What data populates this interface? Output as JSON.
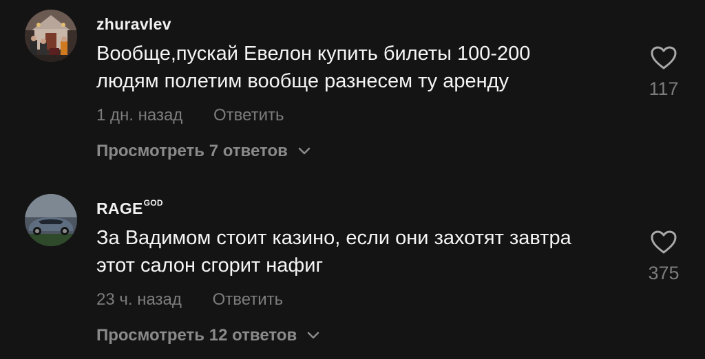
{
  "comments": [
    {
      "username": "zhuravlev",
      "username_sup": "",
      "text_lines": [
        "Вообще,пускай Евелон купить билеты 100-200",
        "людям полетим вообще разнесем ту аренду"
      ],
      "time": "1 дн. назад",
      "reply_label": "Ответить",
      "view_replies": "Просмотреть 7 ответов",
      "likes": "117"
    },
    {
      "username": "RAGE",
      "username_sup": "GOD",
      "text_lines": [
        "За Вадимом стоит казино, если они захотят завтра",
        "этот салон сгорит нафиг"
      ],
      "time": "23 ч. назад",
      "reply_label": "Ответить",
      "view_replies": "Просмотреть 12 ответов",
      "likes": "375"
    }
  ],
  "icons": {
    "like": "heart-outline-icon",
    "expand": "chevron-down-icon"
  },
  "colors": {
    "background": "#141414",
    "primary_text": "#f5f5f5",
    "secondary_text": "#7d7d7d"
  }
}
